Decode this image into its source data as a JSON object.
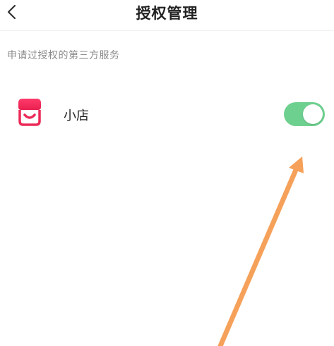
{
  "header": {
    "title": "授权管理",
    "back_icon": "chevron-left-icon"
  },
  "section": {
    "title": "申请过授权的第三方服务"
  },
  "services": [
    {
      "name": "小店",
      "icon": "shop-icon",
      "enabled": true
    }
  ],
  "colors": {
    "toggle_on": "#6ed08f",
    "icon_gradient_top": "#ff3b6b",
    "icon_gradient_bottom": "#e8204f",
    "annotation_arrow": "#f6a15a",
    "section_text": "#8c8c8c",
    "primary_text": "#222222"
  }
}
